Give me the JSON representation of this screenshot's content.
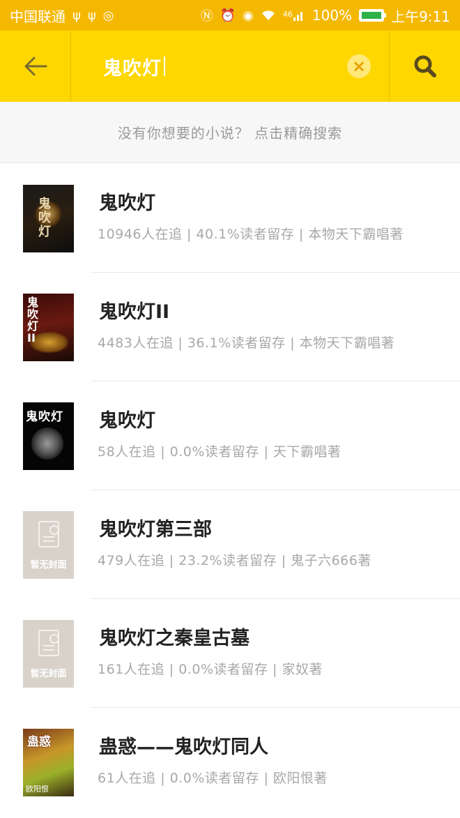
{
  "status_bar": {
    "carrier": "中国联通",
    "battery_percent": "100%",
    "network": "46",
    "time": "上午9:11"
  },
  "search": {
    "query": "鬼吹灯",
    "back_icon": "arrow-left-icon",
    "clear_icon": "close-icon",
    "search_icon": "search-icon"
  },
  "hint": {
    "text": "没有你想要的小说？ 点击精确搜索"
  },
  "results": [
    {
      "title": "鬼吹灯",
      "meta": "10946人在追 | 40.1%读者留存 | 本物天下霸唱著",
      "cover_text": "鬼吹灯"
    },
    {
      "title": "鬼吹灯II",
      "meta": "4483人在追 | 36.1%读者留存 | 本物天下霸唱著",
      "cover_text": "鬼吹灯II"
    },
    {
      "title": "鬼吹灯",
      "meta": "58人在追 | 0.0%读者留存 | 天下霸唱著",
      "cover_text": "鬼吹灯"
    },
    {
      "title": "鬼吹灯第三部",
      "meta": "479人在追 | 23.2%读者留存 | 鬼子六666著",
      "cover_text": "暂无封面"
    },
    {
      "title": "鬼吹灯之秦皇古墓",
      "meta": "161人在追 | 0.0%读者留存 | 家奴著",
      "cover_text": "暂无封面"
    },
    {
      "title": "蛊惑——鬼吹灯同人",
      "meta": "61人在追 | 0.0%读者留存 | 欧阳恨著",
      "cover_text": "蛊惑",
      "cover_author": "欧阳恨"
    }
  ],
  "colors": {
    "status_bar": "#f5b800",
    "header": "#ffd700",
    "title_text": "#222222",
    "meta_text": "#a8a8a8"
  }
}
